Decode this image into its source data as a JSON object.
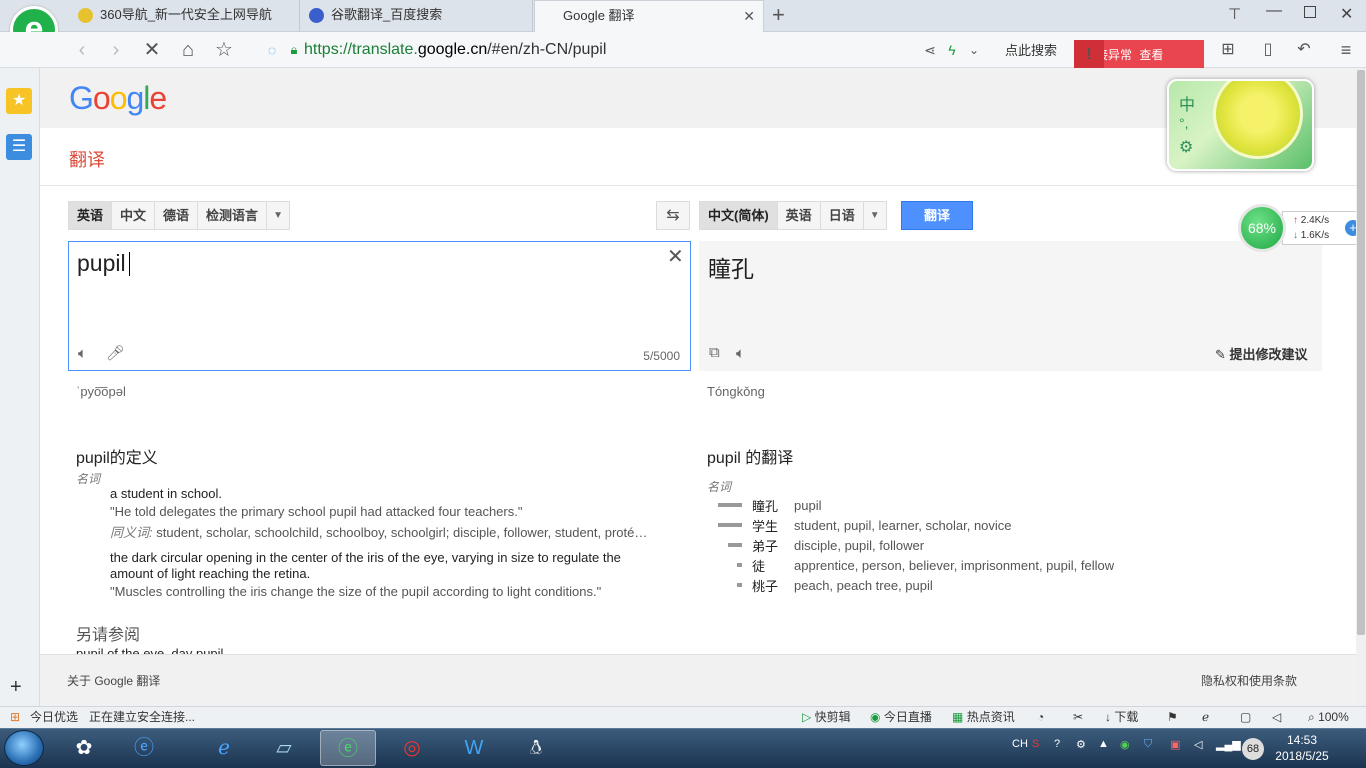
{
  "browser": {
    "tabs": [
      {
        "label": "360导航_新一代安全上网导航"
      },
      {
        "label": "谷歌翻译_百度搜索"
      },
      {
        "label": "Google 翻译"
      }
    ],
    "url_prefix": "https://translate.",
    "url_domain": "google.cn",
    "url_path": "/#en/zh-CN/pupil",
    "click_search": "点此搜索",
    "error_label": "连接异常",
    "error_action": "查看",
    "error_mark": "!"
  },
  "page": {
    "logo": "Google",
    "title": "翻译",
    "source_langs": [
      "英语",
      "中文",
      "德语",
      "检测语言"
    ],
    "target_langs": [
      "中文(简体)",
      "英语",
      "日语"
    ],
    "translate_button": "翻译",
    "source_text": "pupil",
    "char_count": "5/5000",
    "target_text": "瞳孔",
    "suggest_edit": "提出修改建议",
    "source_phonetic": "ˈpyo͞opəl",
    "target_phonetic": "Tóngkǒng"
  },
  "definitions": {
    "heading": "pupil的定义",
    "pos": "名词",
    "items": [
      {
        "gloss": "a student in school.",
        "example": "\"He told delegates the primary school pupil had attacked four teachers.\"",
        "syn_label": "同义词:",
        "synonyms": "student, scholar, schoolchild, schoolboy, schoolgirl; disciple, follower, student, proté…"
      },
      {
        "gloss": "the dark circular opening in the center of the iris of the eye, varying in size to regulate the amount of light reaching the retina.",
        "example": "\"Muscles controlling the iris change the size of the pupil according to light conditions.\""
      }
    ],
    "see_also_heading": "另请参阅",
    "see_also_text": "pupil of the eye, day pupil"
  },
  "translations": {
    "heading": "pupil 的翻译",
    "pos": "名词",
    "rows": [
      {
        "word": "瞳孔",
        "reverse": "pupil",
        "frequency": 1.0
      },
      {
        "word": "学生",
        "reverse": "student, pupil, learner, scholar, novice",
        "frequency": 1.0
      },
      {
        "word": "弟子",
        "reverse": "disciple, pupil, follower",
        "frequency": 0.6
      },
      {
        "word": "徒",
        "reverse": "apprentice, person, believer, imprisonment, pupil, fellow",
        "frequency": 0.2
      },
      {
        "word": "桃子",
        "reverse": "peach, peach tree, pupil",
        "frequency": 0.2
      }
    ]
  },
  "footer": {
    "about": "关于 Google 翻译",
    "privacy": "隐私权和使用条款"
  },
  "widgets": {
    "lemon_char": "中",
    "speed_percent": "68%",
    "upload": "2.4K/s",
    "download": "1.6K/s"
  },
  "status": {
    "daily": "今日优选",
    "loading": "正在建立安全连接...",
    "items": [
      "快剪辑",
      "今日直播",
      "热点资讯",
      "下载"
    ],
    "zoom": "100%"
  },
  "taskbar": {
    "lang": "CH",
    "time": "14:53",
    "date": "2018/5/25",
    "badge": "68"
  }
}
